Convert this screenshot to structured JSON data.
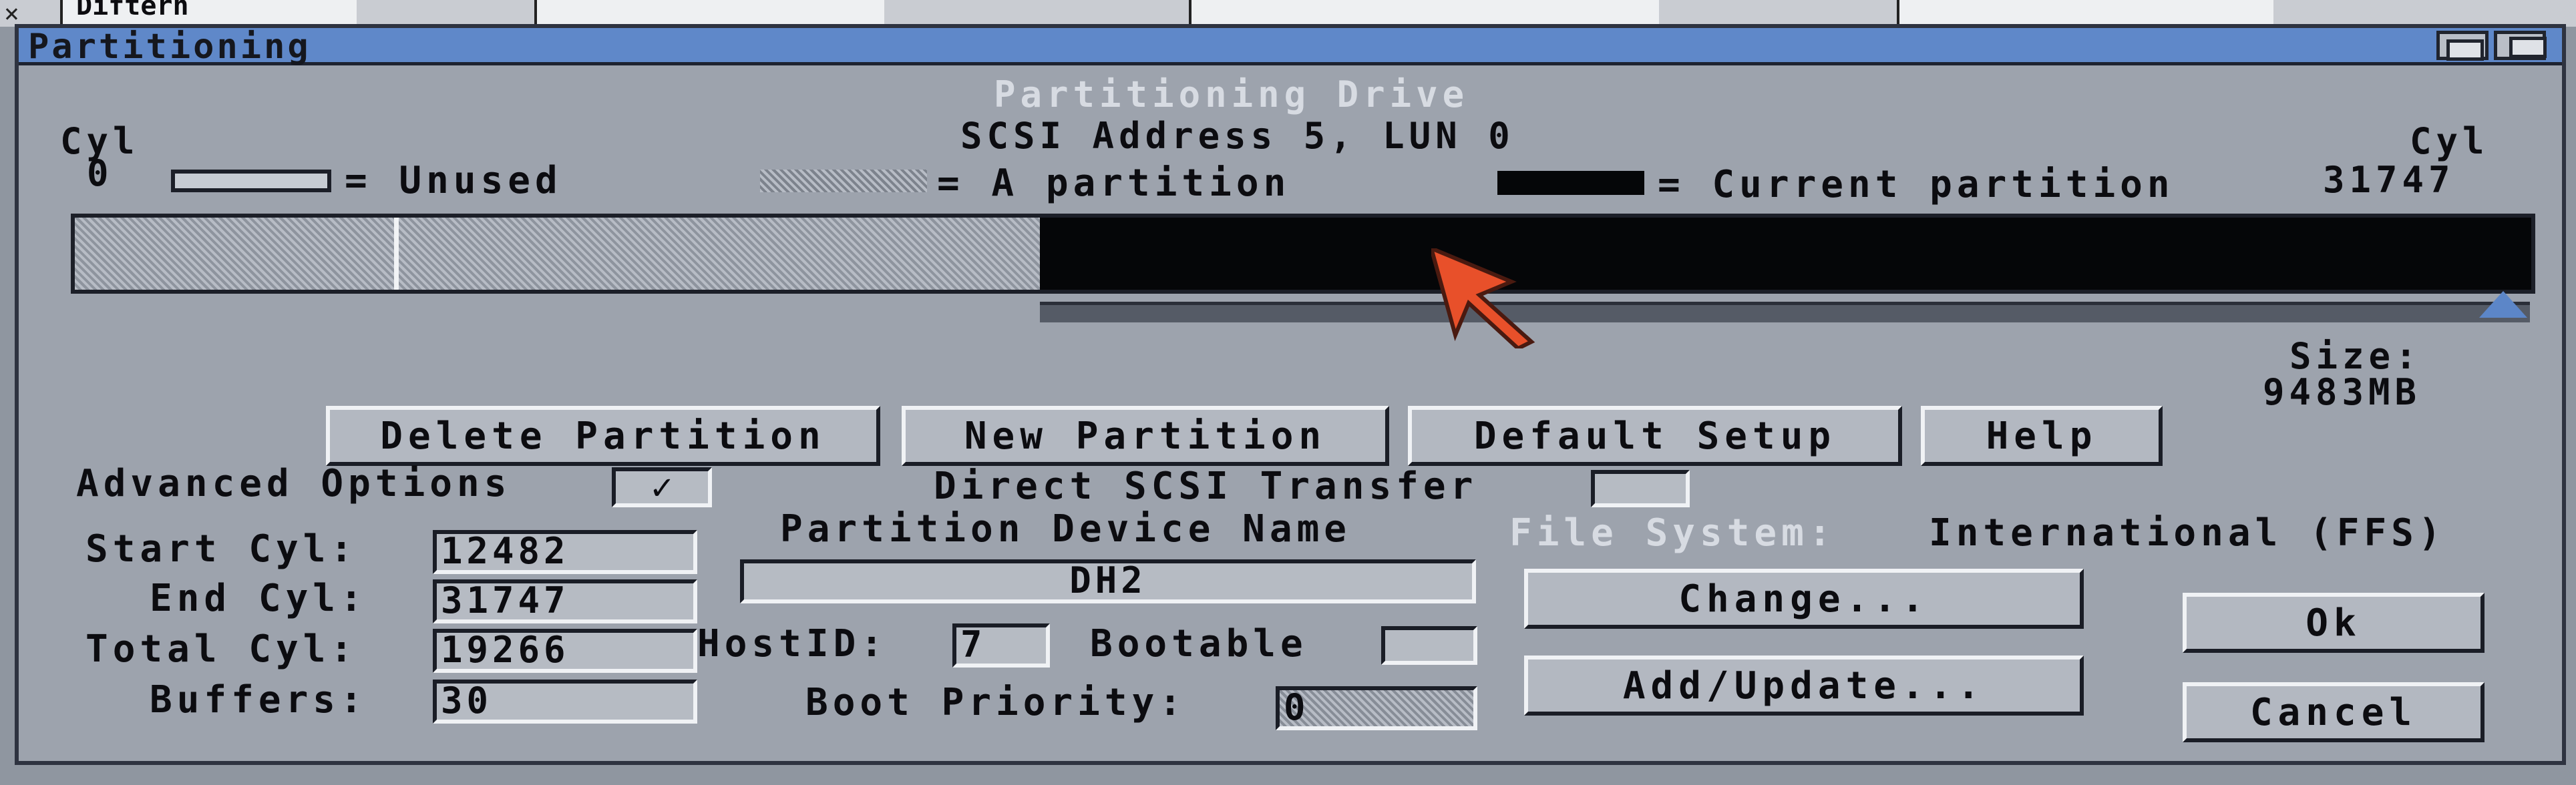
{
  "desktop": {
    "close_glyph": "×",
    "behind_text": "Diftern"
  },
  "window": {
    "title": "Partitioning",
    "heading": "Partitioning Drive",
    "subheading": "SCSI Address 5, LUN 0"
  },
  "cylinders": {
    "left_label": "Cyl",
    "left_value": "0",
    "right_label": "Cyl",
    "right_value": "31747"
  },
  "legend": {
    "unused": "= Unused",
    "partition": "= A partition",
    "current": "= Current partition"
  },
  "size": {
    "label": "Size:",
    "value": "9483MB"
  },
  "buttons": {
    "delete": "Delete Partition",
    "new": "New Partition",
    "default": "Default Setup",
    "help": "Help",
    "change": "Change...",
    "add_update": "Add/Update...",
    "ok": "Ok",
    "cancel": "Cancel"
  },
  "options": {
    "advanced_label": "Advanced Options",
    "advanced_checked": "✓",
    "direct_scsi_label": "Direct SCSI Transfer",
    "direct_scsi_checked": ""
  },
  "fields": {
    "start_cyl_label": "Start Cyl:",
    "start_cyl": "12482",
    "end_cyl_label": "End Cyl:",
    "end_cyl": "31747",
    "total_cyl_label": "Total Cyl:",
    "total_cyl": "19266",
    "buffers_label": "Buffers:",
    "buffers": "30",
    "device_name_label": "Partition Device Name",
    "device_name": "DH2",
    "hostid_label": "HostID:",
    "hostid": "7",
    "bootable_label": "Bootable",
    "bootable": "",
    "boot_priority_label": "Boot Priority:",
    "boot_priority": "0"
  },
  "filesystem": {
    "label": "File System:",
    "value": "International (FFS)"
  },
  "colors": {
    "titlebar": "#5f88c9",
    "window": "#9da3ad",
    "current_partition": "#050608",
    "pointer": "#e8502a"
  },
  "partition_bar": {
    "used_fraction": 0.393,
    "first_boundary_fraction": 0.13
  }
}
